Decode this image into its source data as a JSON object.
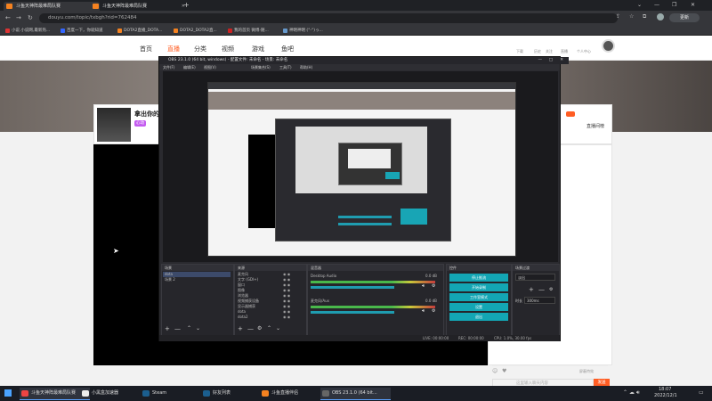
{
  "browser": {
    "tabs": [
      {
        "title": "斗鱼天神阵最难局队赛"
      },
      {
        "title": "斗鱼天神阵最难局队赛"
      }
    ],
    "new_tab_symbol": "+",
    "url": "douyu.com/topic/txbgh?rid=762484",
    "bookmarks": [
      "小说.小说网,最新热...",
      "百度一下，你就知道",
      "DOTA2直播_DOTA...",
      "DOTA2_DOTA2直...",
      "我的首页 微博-随...",
      "神明神明 (°-°)っ..."
    ],
    "update_button": "更新"
  },
  "site": {
    "nav": [
      "首页",
      "直播",
      "分类",
      "视频",
      "游戏",
      "鱼吧"
    ],
    "header_right": [
      "下载",
      "历史",
      "关注",
      "直播",
      "个人中心"
    ],
    "room_title": "拿出你的",
    "room_badge": "心动",
    "chat_label": "直播间榜",
    "chat_placeholder": "这里输入聊天内容",
    "chat_send": "发送",
    "chat_checkbox": "屏蔽特效"
  },
  "obs": {
    "title": "OBS 23.1.0 (64 bit, windows) - 配置文件: 未命名 - 场景: 未命名",
    "menu": [
      "文件(F)",
      "编辑(E)",
      "视图(V)",
      "场景集合(S)",
      "工具(T)",
      "帮助(H)"
    ],
    "docks": {
      "scenes": {
        "title": "场景",
        "items": [
          "dota",
          "场景 2"
        ]
      },
      "sources": {
        "title": "来源",
        "items": [
          "麦克风",
          "文字 (GDI+)",
          "窗口",
          "图像",
          "浏览器",
          "视频捕获设备",
          "显示器捕获",
          "dota",
          "dota2"
        ]
      },
      "mixer": {
        "title": "混音器",
        "channels": [
          {
            "name": "Desktop Audio",
            "level": "0.0 dB",
            "fill": 0.78
          },
          {
            "name": "麦克风/Aux",
            "level": "0.0 dB",
            "fill": 0.78
          }
        ]
      },
      "transitions": {
        "title": "场景过渡",
        "type": "淡出",
        "duration_label": "时长",
        "duration": "300ms"
      },
      "controls": {
        "title": "控件",
        "buttons": [
          "停止推流",
          "开始录制",
          "工作室模式",
          "设置",
          "退出"
        ]
      }
    },
    "status": {
      "live": "LIVE: 00:00:00",
      "rec": "REC: 00:00:00",
      "cpu": "CPU: 1.0%, 30.00 fps"
    }
  },
  "taskbar": {
    "items": [
      "斗鱼天神阵最难局队赛",
      "小黑盒加速器",
      "Steam",
      "好友列表",
      "斗鱼直播伴侣",
      "OBS 23.1.0 (64 bit..."
    ],
    "time": "18:07",
    "date": "2022/12/1"
  },
  "colors": {
    "accent_orange": "#ff5d23",
    "obs_teal": "#18a5b5",
    "douyu_orange": "#f58220"
  }
}
